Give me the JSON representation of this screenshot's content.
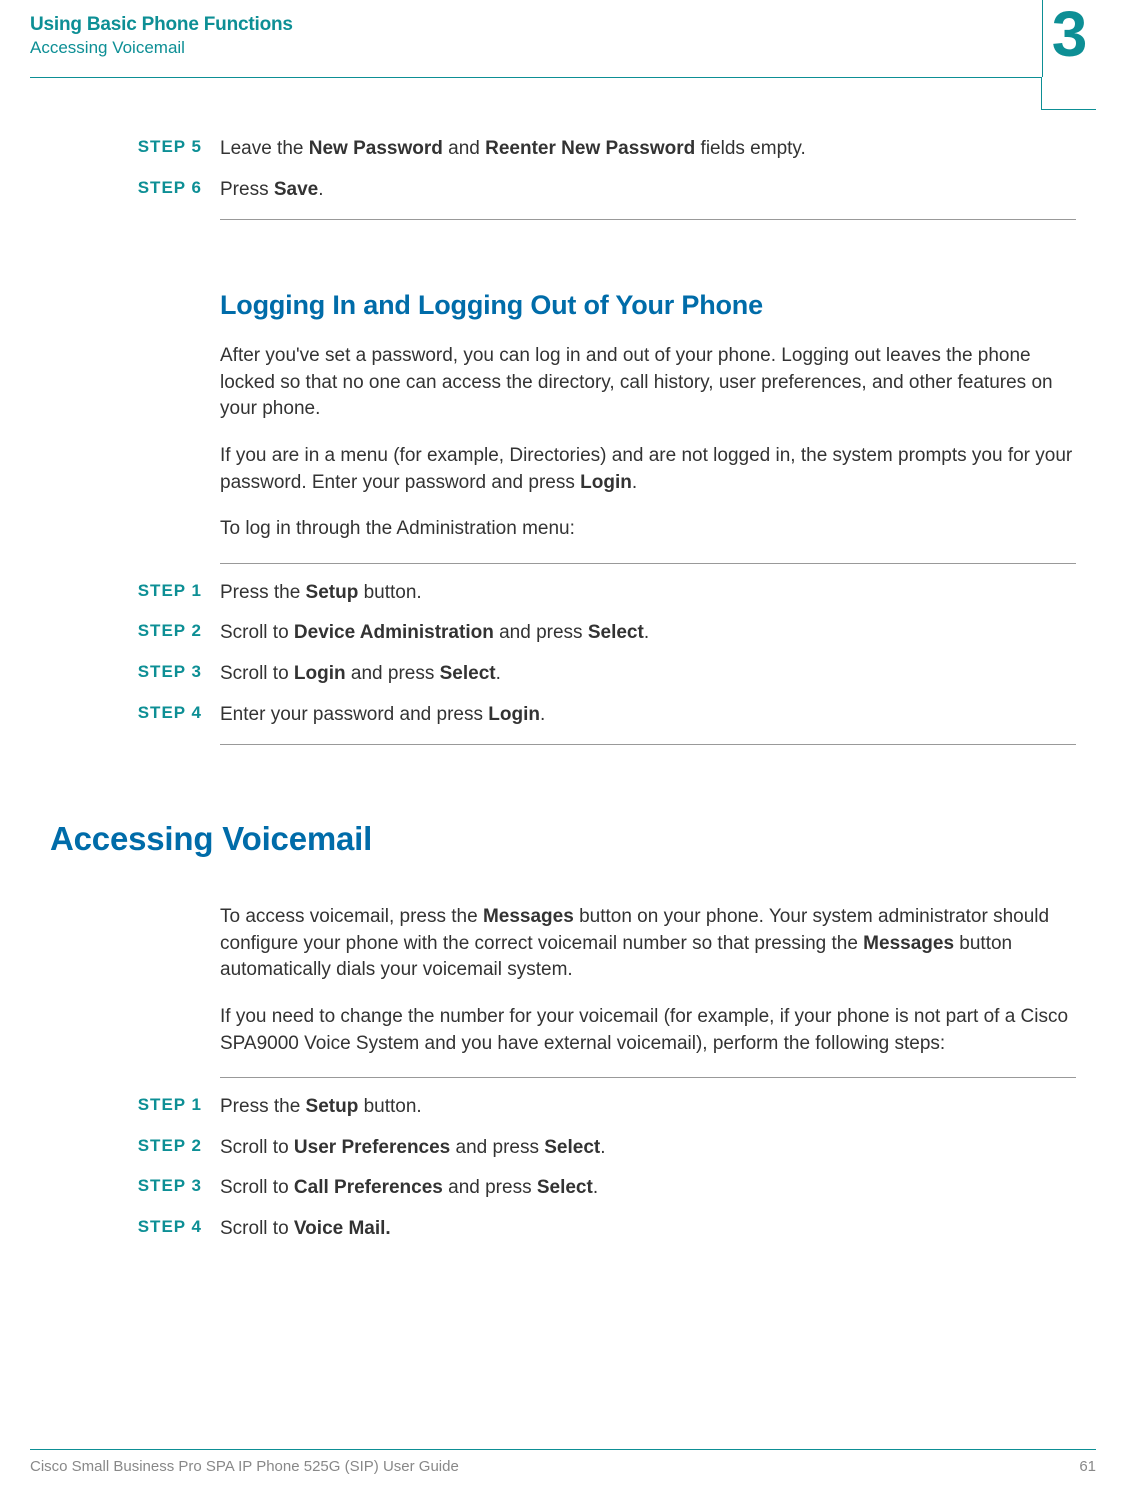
{
  "header": {
    "title": "Using Basic Phone Functions",
    "subtitle": "Accessing Voicemail",
    "chapter_num": "3"
  },
  "steps_top": [
    {
      "label": "STEP 5",
      "pre": "Leave the ",
      "b1": "New Password",
      "mid": " and ",
      "b2": "Reenter New Password",
      "post": " fields empty."
    },
    {
      "label": "STEP 6",
      "pre": "Press ",
      "b1": "Save",
      "mid": ".",
      "b2": "",
      "post": ""
    }
  ],
  "section_login": {
    "heading": "Logging In and Logging Out of Your Phone",
    "p1": "After you've set a password, you can log in and out of your phone. Logging out leaves the phone locked so that no one can access the directory, call history, user preferences, and other features on your phone.",
    "p2a": "If you are in a menu (for example, Directories) and are not logged in, the system prompts you for your password. Enter your password and press ",
    "p2b": "Login",
    "p2c": ".",
    "p3": "To log in through the Administration menu:"
  },
  "steps_login": [
    {
      "label": "STEP 1",
      "pre": "Press the ",
      "b1": "Setup",
      "mid": " button.",
      "b2": "",
      "post": ""
    },
    {
      "label": "STEP 2",
      "pre": "Scroll to ",
      "b1": "Device Administration",
      "mid": " and press ",
      "b2": "Select",
      "post": "."
    },
    {
      "label": "STEP 3",
      "pre": "Scroll to ",
      "b1": "Login",
      "mid": " and press ",
      "b2": "Select",
      "post": "."
    },
    {
      "label": "STEP 4",
      "pre": "Enter your password and press ",
      "b1": "Login",
      "mid": ".",
      "b2": "",
      "post": ""
    }
  ],
  "section_vm": {
    "heading": "Accessing Voicemail",
    "p1a": "To access voicemail, press the ",
    "p1b": "Messages",
    "p1c": " button on your phone. Your system administrator should configure your phone with the correct voicemail number so that pressing the ",
    "p1d": "Messages",
    "p1e": " button automatically dials your voicemail system.",
    "p2": "If you need to change the number for your voicemail (for example, if your phone is not part of a Cisco SPA9000 Voice System and you have external voicemail), perform the following steps:"
  },
  "steps_vm": [
    {
      "label": "STEP 1",
      "pre": "Press the ",
      "b1": "Setup",
      "mid": " button.",
      "b2": "",
      "post": ""
    },
    {
      "label": "STEP 2",
      "pre": "Scroll to ",
      "b1": "User Preferences",
      "mid": " and press ",
      "b2": "Select",
      "post": "."
    },
    {
      "label": "STEP 3",
      "pre": "Scroll to ",
      "b1": "Call Preferences",
      "mid": " and press ",
      "b2": "Select",
      "post": "."
    },
    {
      "label": "STEP 4",
      "pre": "Scroll to ",
      "b1": "Voice Mail.",
      "mid": "",
      "b2": "",
      "post": ""
    }
  ],
  "footer": {
    "left": "Cisco Small Business Pro SPA IP Phone 525G (SIP) User Guide",
    "right": "61"
  }
}
